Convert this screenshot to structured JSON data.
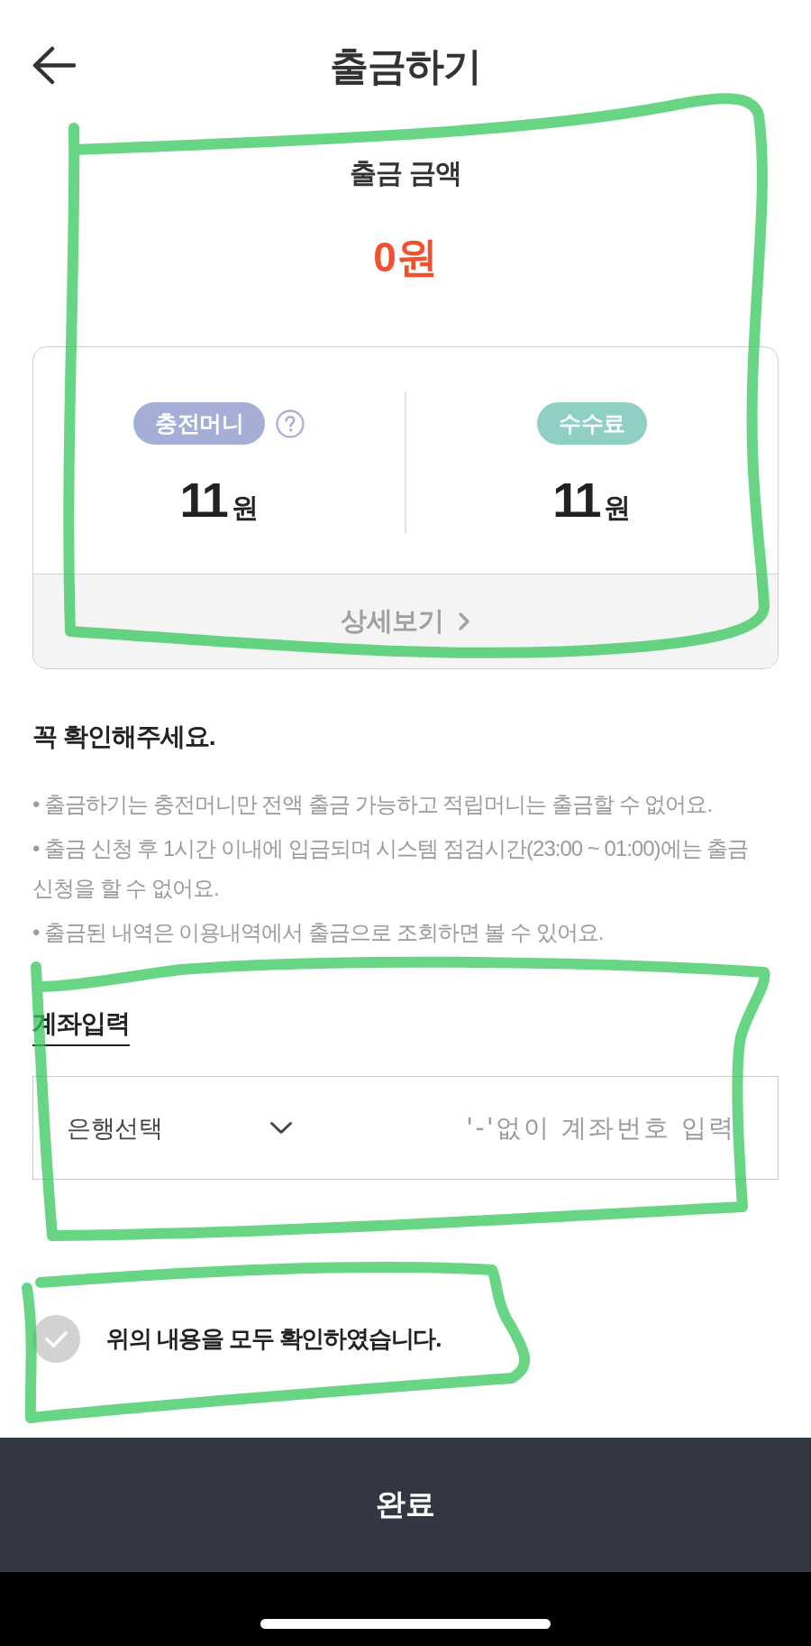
{
  "header": {
    "title": "출금하기"
  },
  "amount": {
    "label": "출금 금액",
    "value": "0원"
  },
  "summary_card": {
    "items": [
      {
        "badge": "충전머니",
        "color": "#a5aed6",
        "kind": "help",
        "amount": "11",
        "unit": "원"
      },
      {
        "badge": "수수료",
        "color": "#8fcfc4",
        "kind": "plain",
        "amount": "11",
        "unit": "원"
      }
    ],
    "detail_link": "상세보기"
  },
  "notice": {
    "title": "꼭 확인해주세요.",
    "items": [
      "• 출금하기는 충전머니만 전액 출금 가능하고 적립머니는 출금할 수 없어요.",
      "• 출금 신청 후 1시간 이내에 입금되며 시스템 점검시간(23:00 ~ 01:00)에는 출금 신청을 할 수 없어요.",
      "• 출금된 내역은 이용내역에서 출금으로 조회하면 볼 수 있어요."
    ]
  },
  "account": {
    "title": "계좌입력",
    "bank_select": {
      "value": "은행선택"
    },
    "account_number": {
      "placeholder": "'-'없이 계좌번호 입력"
    }
  },
  "agreement": {
    "label": "위의 내용을 모두 확인하였습니다.",
    "checked": false
  },
  "submit_button": {
    "label": "완료"
  }
}
